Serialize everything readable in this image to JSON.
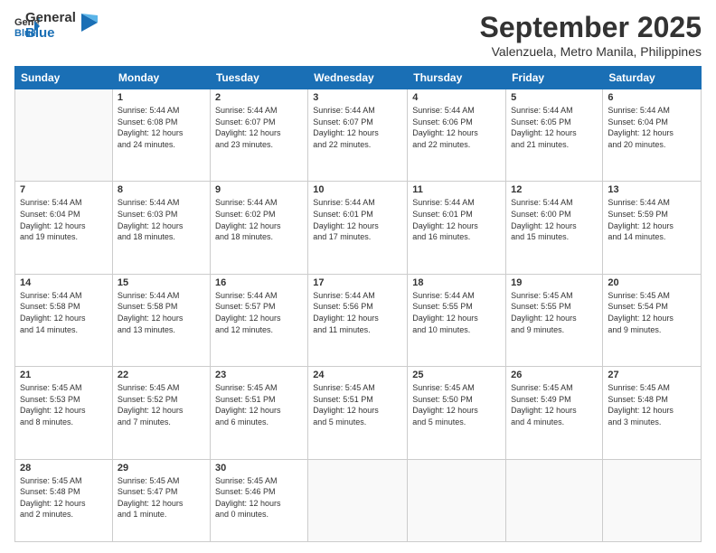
{
  "logo": {
    "line1": "General",
    "line2": "Blue"
  },
  "title": "September 2025",
  "subtitle": "Valenzuela, Metro Manila, Philippines",
  "weekdays": [
    "Sunday",
    "Monday",
    "Tuesday",
    "Wednesday",
    "Thursday",
    "Friday",
    "Saturday"
  ],
  "weeks": [
    [
      {
        "day": "",
        "info": ""
      },
      {
        "day": "1",
        "info": "Sunrise: 5:44 AM\nSunset: 6:08 PM\nDaylight: 12 hours\nand 24 minutes."
      },
      {
        "day": "2",
        "info": "Sunrise: 5:44 AM\nSunset: 6:07 PM\nDaylight: 12 hours\nand 23 minutes."
      },
      {
        "day": "3",
        "info": "Sunrise: 5:44 AM\nSunset: 6:07 PM\nDaylight: 12 hours\nand 22 minutes."
      },
      {
        "day": "4",
        "info": "Sunrise: 5:44 AM\nSunset: 6:06 PM\nDaylight: 12 hours\nand 22 minutes."
      },
      {
        "day": "5",
        "info": "Sunrise: 5:44 AM\nSunset: 6:05 PM\nDaylight: 12 hours\nand 21 minutes."
      },
      {
        "day": "6",
        "info": "Sunrise: 5:44 AM\nSunset: 6:04 PM\nDaylight: 12 hours\nand 20 minutes."
      }
    ],
    [
      {
        "day": "7",
        "info": "Sunrise: 5:44 AM\nSunset: 6:04 PM\nDaylight: 12 hours\nand 19 minutes."
      },
      {
        "day": "8",
        "info": "Sunrise: 5:44 AM\nSunset: 6:03 PM\nDaylight: 12 hours\nand 18 minutes."
      },
      {
        "day": "9",
        "info": "Sunrise: 5:44 AM\nSunset: 6:02 PM\nDaylight: 12 hours\nand 18 minutes."
      },
      {
        "day": "10",
        "info": "Sunrise: 5:44 AM\nSunset: 6:01 PM\nDaylight: 12 hours\nand 17 minutes."
      },
      {
        "day": "11",
        "info": "Sunrise: 5:44 AM\nSunset: 6:01 PM\nDaylight: 12 hours\nand 16 minutes."
      },
      {
        "day": "12",
        "info": "Sunrise: 5:44 AM\nSunset: 6:00 PM\nDaylight: 12 hours\nand 15 minutes."
      },
      {
        "day": "13",
        "info": "Sunrise: 5:44 AM\nSunset: 5:59 PM\nDaylight: 12 hours\nand 14 minutes."
      }
    ],
    [
      {
        "day": "14",
        "info": "Sunrise: 5:44 AM\nSunset: 5:58 PM\nDaylight: 12 hours\nand 14 minutes."
      },
      {
        "day": "15",
        "info": "Sunrise: 5:44 AM\nSunset: 5:58 PM\nDaylight: 12 hours\nand 13 minutes."
      },
      {
        "day": "16",
        "info": "Sunrise: 5:44 AM\nSunset: 5:57 PM\nDaylight: 12 hours\nand 12 minutes."
      },
      {
        "day": "17",
        "info": "Sunrise: 5:44 AM\nSunset: 5:56 PM\nDaylight: 12 hours\nand 11 minutes."
      },
      {
        "day": "18",
        "info": "Sunrise: 5:44 AM\nSunset: 5:55 PM\nDaylight: 12 hours\nand 10 minutes."
      },
      {
        "day": "19",
        "info": "Sunrise: 5:45 AM\nSunset: 5:55 PM\nDaylight: 12 hours\nand 9 minutes."
      },
      {
        "day": "20",
        "info": "Sunrise: 5:45 AM\nSunset: 5:54 PM\nDaylight: 12 hours\nand 9 minutes."
      }
    ],
    [
      {
        "day": "21",
        "info": "Sunrise: 5:45 AM\nSunset: 5:53 PM\nDaylight: 12 hours\nand 8 minutes."
      },
      {
        "day": "22",
        "info": "Sunrise: 5:45 AM\nSunset: 5:52 PM\nDaylight: 12 hours\nand 7 minutes."
      },
      {
        "day": "23",
        "info": "Sunrise: 5:45 AM\nSunset: 5:51 PM\nDaylight: 12 hours\nand 6 minutes."
      },
      {
        "day": "24",
        "info": "Sunrise: 5:45 AM\nSunset: 5:51 PM\nDaylight: 12 hours\nand 5 minutes."
      },
      {
        "day": "25",
        "info": "Sunrise: 5:45 AM\nSunset: 5:50 PM\nDaylight: 12 hours\nand 5 minutes."
      },
      {
        "day": "26",
        "info": "Sunrise: 5:45 AM\nSunset: 5:49 PM\nDaylight: 12 hours\nand 4 minutes."
      },
      {
        "day": "27",
        "info": "Sunrise: 5:45 AM\nSunset: 5:48 PM\nDaylight: 12 hours\nand 3 minutes."
      }
    ],
    [
      {
        "day": "28",
        "info": "Sunrise: 5:45 AM\nSunset: 5:48 PM\nDaylight: 12 hours\nand 2 minutes."
      },
      {
        "day": "29",
        "info": "Sunrise: 5:45 AM\nSunset: 5:47 PM\nDaylight: 12 hours\nand 1 minute."
      },
      {
        "day": "30",
        "info": "Sunrise: 5:45 AM\nSunset: 5:46 PM\nDaylight: 12 hours\nand 0 minutes."
      },
      {
        "day": "",
        "info": ""
      },
      {
        "day": "",
        "info": ""
      },
      {
        "day": "",
        "info": ""
      },
      {
        "day": "",
        "info": ""
      }
    ]
  ]
}
